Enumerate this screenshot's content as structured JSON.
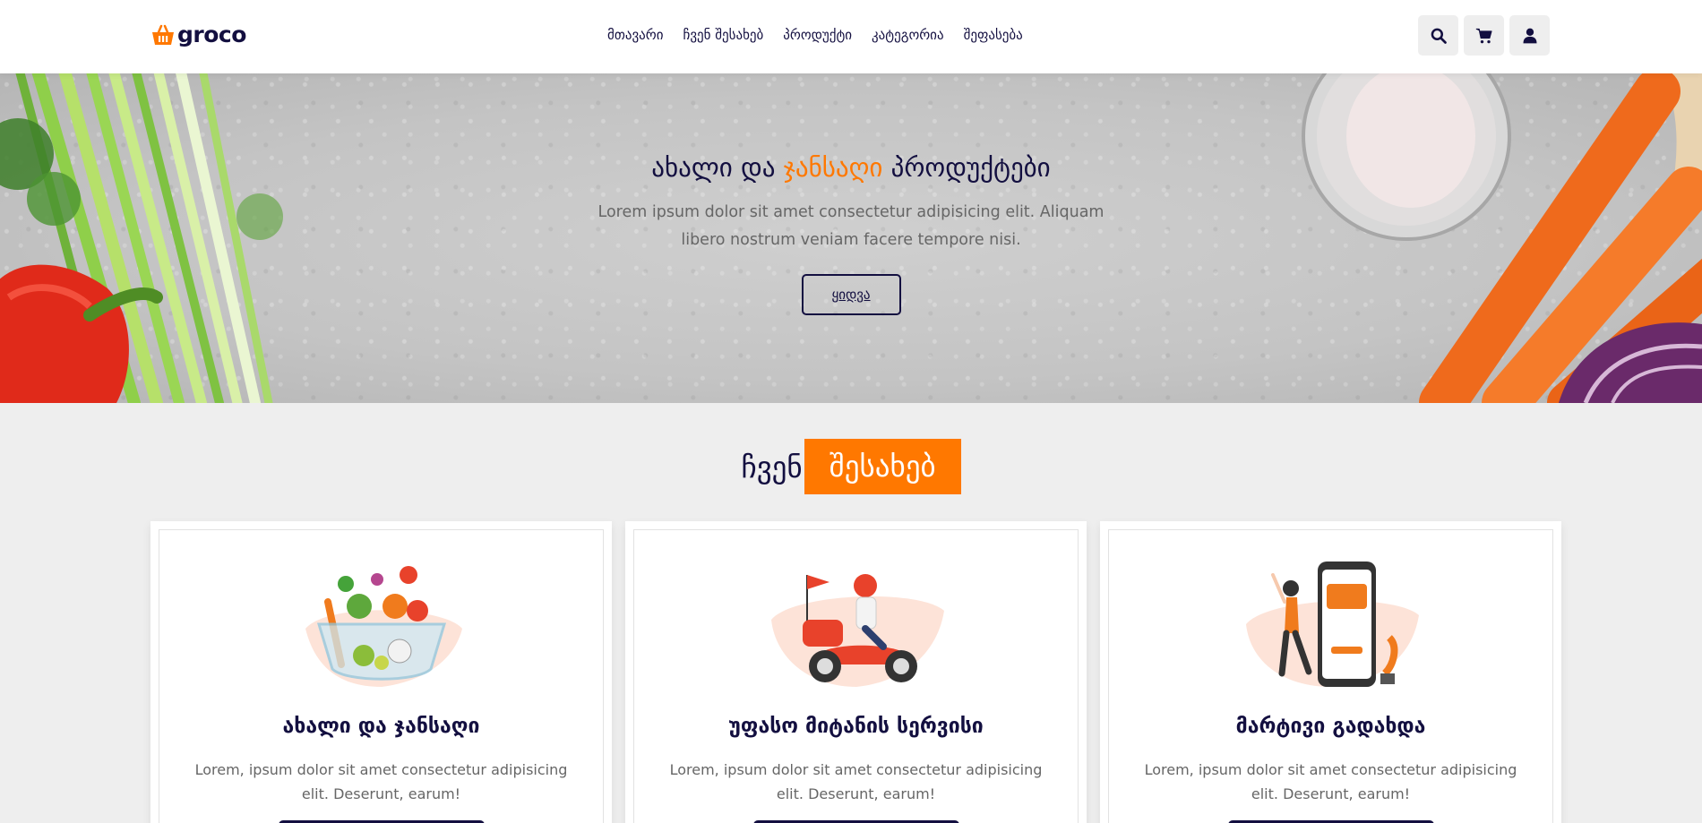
{
  "brand": {
    "name": "groco",
    "accent": "#ff7800",
    "dark": "#130f40"
  },
  "nav": {
    "items": [
      {
        "label": "მთავარი"
      },
      {
        "label": "ჩვენ შესახებ"
      },
      {
        "label": "პროდუქტი"
      },
      {
        "label": "კატეგორია"
      },
      {
        "label": "შეფასება"
      }
    ]
  },
  "header_icons": [
    "search-icon",
    "cart-icon",
    "user-icon"
  ],
  "hero": {
    "title_part1": "ახალი და ",
    "title_accent": "ჯანსაღი",
    "title_part2": " პროდუქტები",
    "description": "Lorem ipsum dolor sit amet consectetur adipisicing elit. Aliquam libero nostrum veniam facere tempore nisi.",
    "button": "ყიდვა"
  },
  "about": {
    "heading_plain": "ჩვენ",
    "heading_highlight": "შესახებ",
    "cards": [
      {
        "title": "ახალი და ჯანსაღი",
        "text": "Lorem, ipsum dolor sit amet consectetur adipisicing elit. Deserunt, earum!",
        "image": "vegetable-bowl-illustration"
      },
      {
        "title": "უფასო მიტანის სერვისი",
        "text": "Lorem, ipsum dolor sit amet consectetur adipisicing elit. Deserunt, earum!",
        "image": "delivery-scooter-illustration"
      },
      {
        "title": "მარტივი გადახდა",
        "text": "Lorem, ipsum dolor sit amet consectetur adipisicing elit. Deserunt, earum!",
        "image": "mobile-payment-illustration"
      }
    ]
  }
}
